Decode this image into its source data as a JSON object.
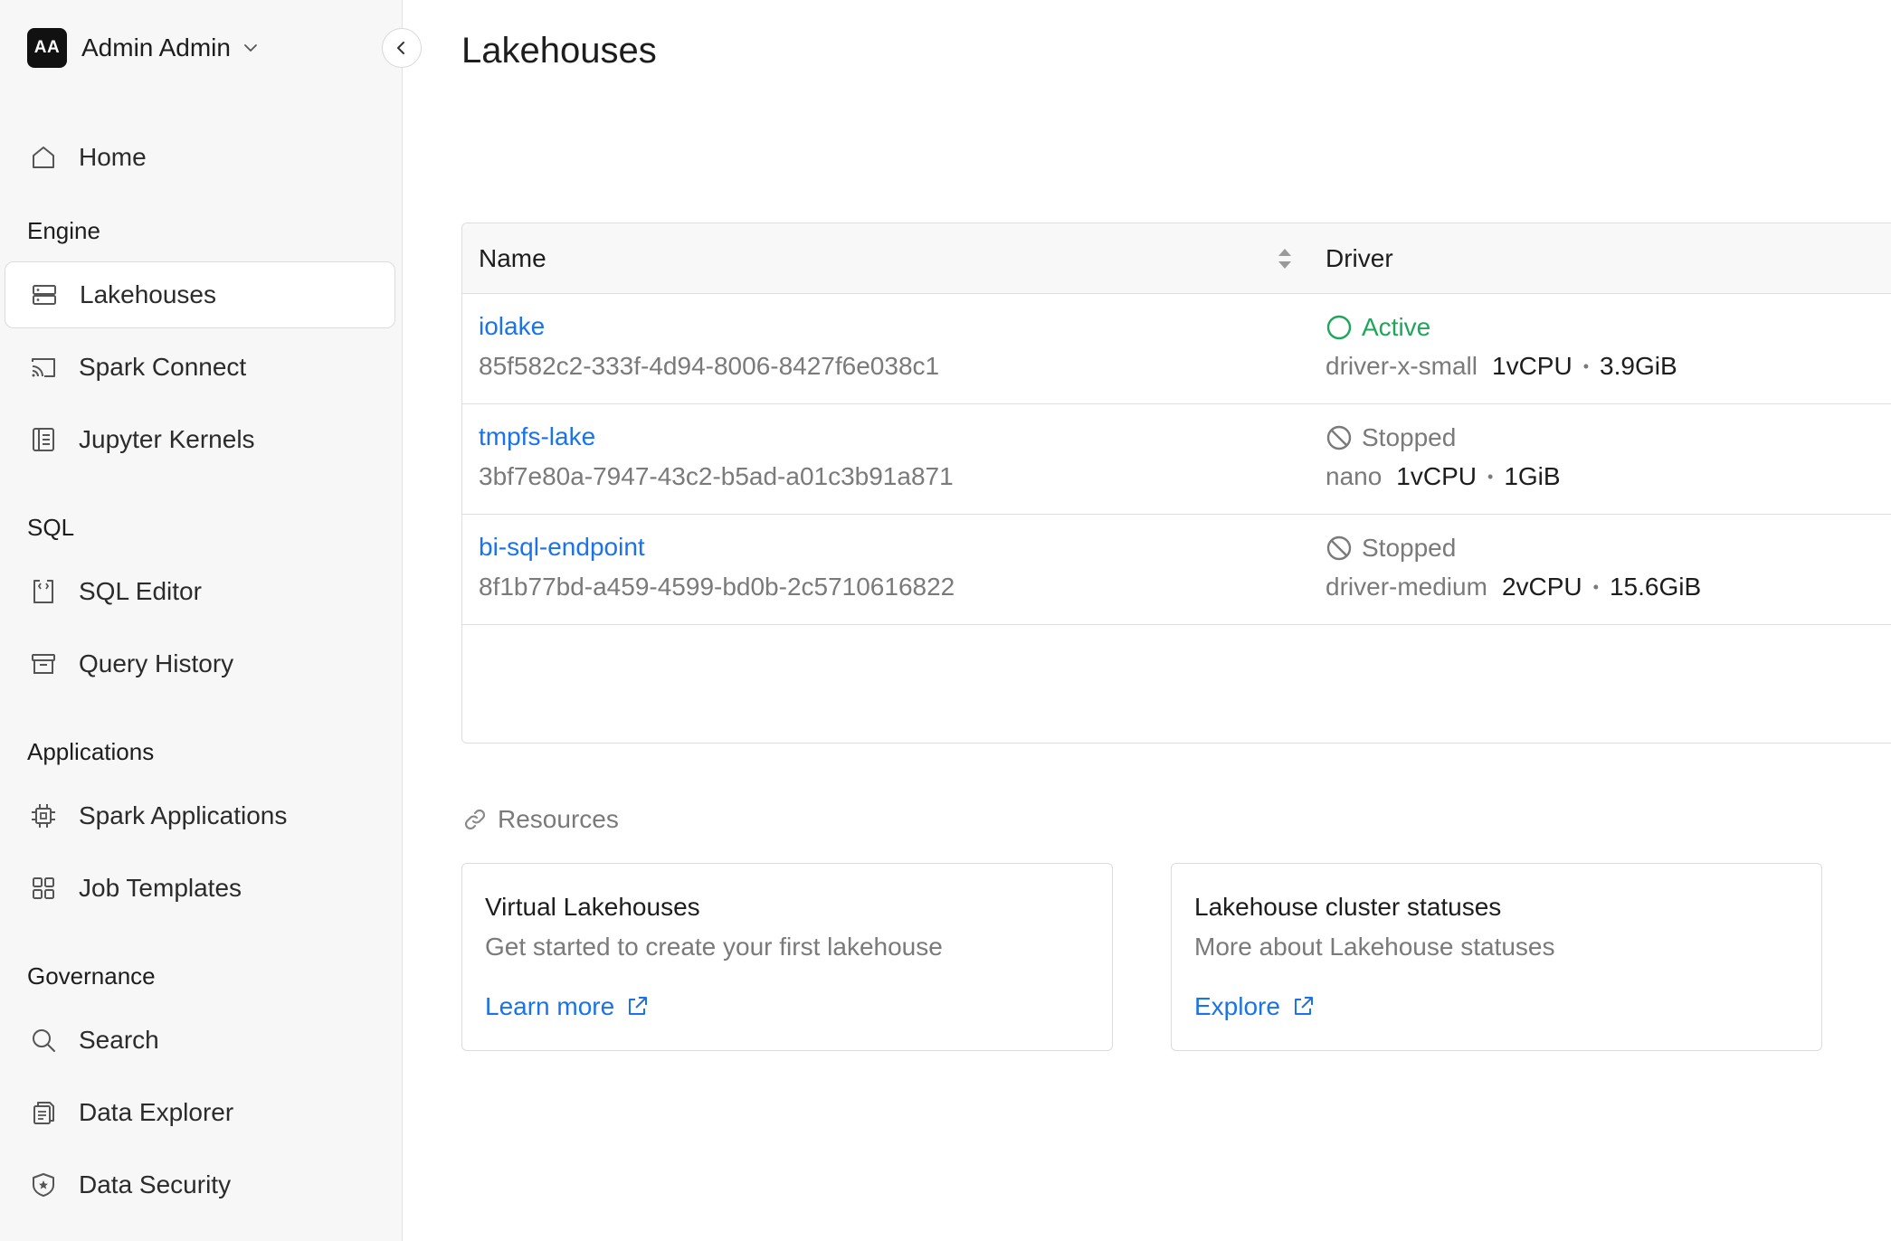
{
  "user": {
    "initials": "AA",
    "name": "Admin Admin"
  },
  "nav": {
    "home": "Home",
    "sections": {
      "engine": "Engine",
      "sql": "SQL",
      "applications": "Applications",
      "governance": "Governance"
    },
    "items": {
      "lakehouses": "Lakehouses",
      "spark_connect": "Spark Connect",
      "jupyter_kernels": "Jupyter Kernels",
      "sql_editor": "SQL Editor",
      "query_history": "Query History",
      "spark_applications": "Spark Applications",
      "job_templates": "Job Templates",
      "search": "Search",
      "data_explorer": "Data Explorer",
      "data_security": "Data Security"
    },
    "active": "lakehouses"
  },
  "page": {
    "title": "Lakehouses"
  },
  "table": {
    "columns": {
      "name": "Name",
      "driver": "Driver"
    },
    "rows": [
      {
        "name": "iolake",
        "id": "85f582c2-333f-4d94-8006-8427f6e038c1",
        "status": "Active",
        "size": "driver-x-small",
        "cpu": "1vCPU",
        "memory": "3.9GiB"
      },
      {
        "name": "tmpfs-lake",
        "id": "3bf7e80a-7947-43c2-b5ad-a01c3b91a871",
        "status": "Stopped",
        "size": "nano",
        "cpu": "1vCPU",
        "memory": "1GiB"
      },
      {
        "name": "bi-sql-endpoint",
        "id": "8f1b77bd-a459-4599-bd0b-2c5710616822",
        "status": "Stopped",
        "size": "driver-medium",
        "cpu": "2vCPU",
        "memory": "15.6GiB"
      }
    ]
  },
  "resources": {
    "heading": "Resources",
    "cards": [
      {
        "title": "Virtual Lakehouses",
        "description": "Get started to create your first lakehouse",
        "link": "Learn more"
      },
      {
        "title": "Lakehouse cluster statuses",
        "description": "More about Lakehouse statuses",
        "link": "Explore"
      }
    ]
  },
  "colors": {
    "link": "#1a73e8",
    "active": "#1ea65a",
    "muted": "#7a7a7a"
  }
}
